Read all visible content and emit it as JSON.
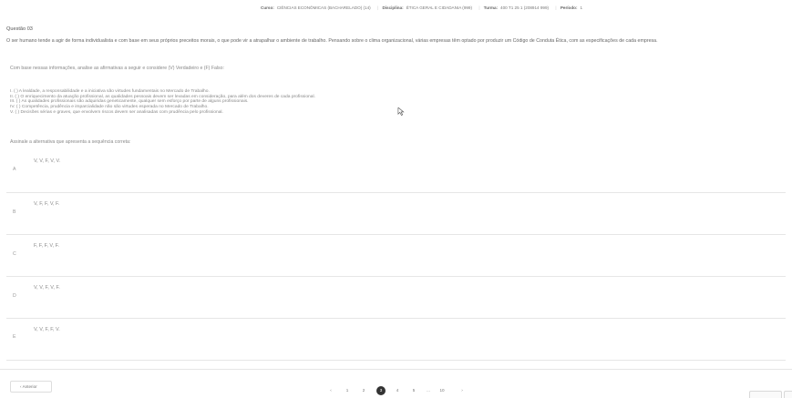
{
  "header": {
    "curso_label": "Curso:",
    "curso_value": "CIÊNCIAS ECONÔMICAS (BACHARELADO) (14)",
    "disciplina_label": "Disciplina:",
    "disciplina_value": "ÉTICA GERAL E CIDADANIA (999)",
    "turma_label": "Turma:",
    "turma_value": "400 T1 25 1 (208914 999)",
    "periodo_label": "Período:",
    "periodo_value": "1"
  },
  "question": {
    "title": "Questão 03",
    "statement": "O ser humano tende a agir de forma individualista e com base em seus próprios preceitos morais, o que pode vir a atrapalhar o ambiente de trabalho. Pensando sobre o clima organizacional, várias empresas têm optado por produzir um Código de Conduta Ética, com as especificações de cada empresa.",
    "intro": "Com base nessas informações, analise as afirmativas a seguir e considere (V) Verdadeiro e (F) Falso:",
    "items": [
      "I. ( ) A lealdade, a responsabilidade e a iniciativa são virtudes fundamentais no Mercado de Trabalho.",
      "II. ( ) O enriquecimento da atuação profissional, as qualidades pessoais devem ser levadas em consideração, para além dos deveres de cada profissional.",
      "III. ( ) As qualidades profissionais são adquiridas geneticamente, qualquer sem esforço por parte de alguns profissionais.",
      "IV. ( ) Competência, prudência e imparcialidade não são virtudes esperada no Mercado de Trabalho.",
      "V. ( ) Decisões sérias e graves, que envolvem riscos devem ser analisadas com prudência pelo profissional."
    ],
    "prompt": "Assinale a alternativa que apresenta a sequência correta:"
  },
  "options": [
    {
      "letter": "A",
      "text": "V, V, F, V, V."
    },
    {
      "letter": "B",
      "text": "V, F, F, V, F."
    },
    {
      "letter": "C",
      "text": "F, F, F, V, F."
    },
    {
      "letter": "D",
      "text": "V, V, F, V, F."
    },
    {
      "letter": "E",
      "text": "V, V, F, F, V."
    }
  ],
  "navigation": {
    "prev_label": "Anterior",
    "prev_arrow": "‹",
    "next_arrow": "›",
    "pages": [
      "1",
      "2",
      "3",
      "4",
      "5",
      "...",
      "10"
    ],
    "active_page": "3"
  },
  "icons": {
    "cursor": "cursor-arrow-icon",
    "prev": "chevron-left-icon",
    "next": "chevron-right-icon"
  }
}
